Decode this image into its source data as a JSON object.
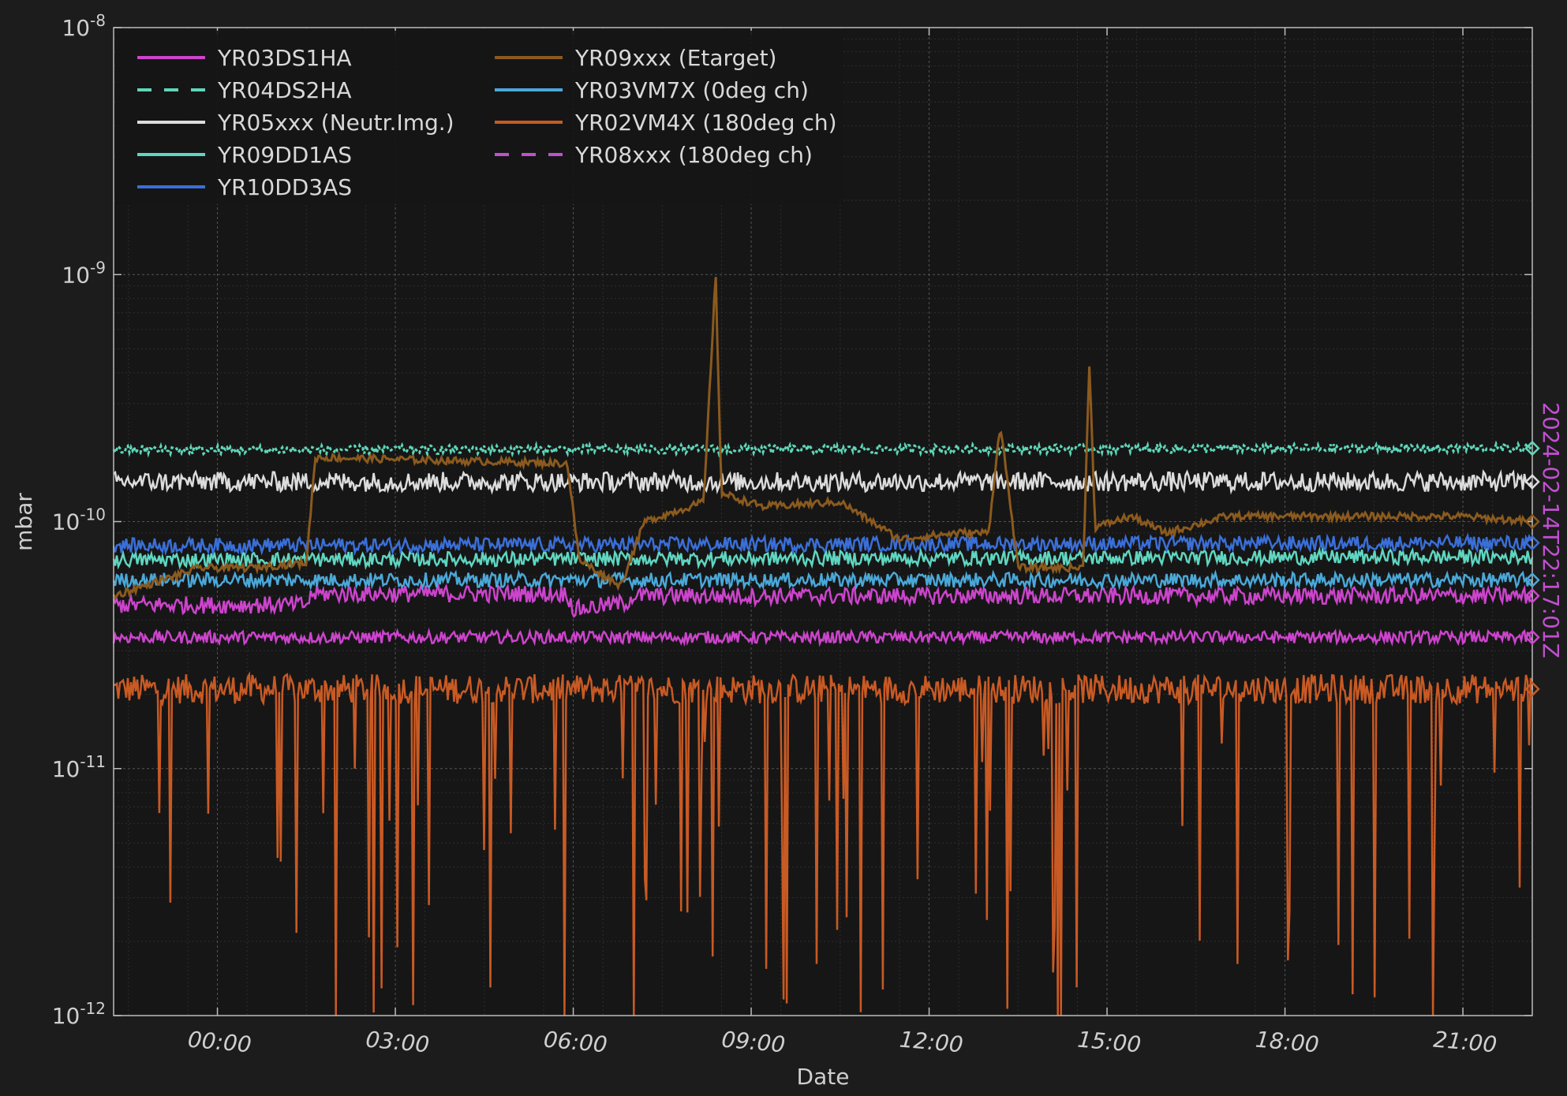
{
  "chart_data": {
    "type": "line",
    "title": "",
    "xlabel": "Date",
    "ylabel": "mbar",
    "y_scale": "log",
    "ylim": [
      1e-12,
      1e-08
    ],
    "x_unit": "hours",
    "xlim": [
      -1.75,
      22.17
    ],
    "x_ticks": [
      {
        "value": 0,
        "label": "00:00"
      },
      {
        "value": 3,
        "label": "03:00"
      },
      {
        "value": 6,
        "label": "06:00"
      },
      {
        "value": 9,
        "label": "09:00"
      },
      {
        "value": 12,
        "label": "12:00"
      },
      {
        "value": 15,
        "label": "15:00"
      },
      {
        "value": 18,
        "label": "18:00"
      },
      {
        "value": 21,
        "label": "21:00"
      }
    ],
    "y_ticks": [
      {
        "value": 1e-12,
        "base": "10",
        "exp": "-12"
      },
      {
        "value": 1e-11,
        "base": "10",
        "exp": "-11"
      },
      {
        "value": 1e-10,
        "base": "10",
        "exp": "-10"
      },
      {
        "value": 1e-09,
        "base": "10",
        "exp": "-9"
      },
      {
        "value": 1e-08,
        "base": "10",
        "exp": "-8"
      }
    ],
    "grid": true,
    "legend_position": "top-left",
    "timestamp": "2024-02-14T22:17:01Z",
    "timestamp_color": "#c050d0",
    "series": [
      {
        "name": "YR03DS1HA",
        "color": "#cc44cc",
        "dash": "solid",
        "points": [
          [
            -1.75,
            4.6e-11
          ],
          [
            1.5,
            4.6e-11
          ],
          [
            1.6,
            5.1e-11
          ],
          [
            5.9,
            5.1e-11
          ],
          [
            6.0,
            4.4e-11
          ],
          [
            6.9,
            4.7e-11
          ],
          [
            7.0,
            5e-11
          ],
          [
            22.17,
            5e-11
          ]
        ]
      },
      {
        "name": "YR03DS1HA",
        "color": "#cc44cc",
        "dash": "solid",
        "points": [
          [
            -1.75,
            3.4e-11
          ],
          [
            22.17,
            3.4e-11
          ]
        ]
      },
      {
        "name": "YR04DS2HA",
        "color": "#5fd6b8",
        "dash": "dashed",
        "points": [
          [
            -1.75,
            1.95e-10
          ],
          [
            22.17,
            1.98e-10
          ]
        ]
      },
      {
        "name": "YR05xxx (Neutr.Img.)",
        "color": "#dcdcdc",
        "dash": "solid",
        "points": [
          [
            -1.75,
            1.45e-10
          ],
          [
            22.17,
            1.45e-10
          ]
        ]
      },
      {
        "name": "YR09DD1AS",
        "color": "#5fd6c0",
        "dash": "solid",
        "points": [
          [
            -1.75,
            7e-11
          ],
          [
            22.17,
            7.2e-11
          ]
        ]
      },
      {
        "name": "YR10DD3AS",
        "color": "#3a6fd8",
        "dash": "solid",
        "points": [
          [
            -1.75,
            8e-11
          ],
          [
            22.17,
            8.2e-11
          ]
        ]
      },
      {
        "name": "YR09xxx (Etarget)",
        "color": "#8b5a1e",
        "dash": "solid",
        "points": [
          [
            -1.75,
            5e-11
          ],
          [
            -0.3,
            6.5e-11
          ],
          [
            0.5,
            6.5e-11
          ],
          [
            1.5,
            6.8e-11
          ],
          [
            1.65,
            1.82e-10
          ],
          [
            5.9,
            1.72e-10
          ],
          [
            6.1,
            7e-11
          ],
          [
            6.8,
            5.5e-11
          ],
          [
            7.2,
            1e-10
          ],
          [
            8.2,
            1.2e-10
          ],
          [
            8.4,
            1e-09
          ],
          [
            8.5,
            1.3e-10
          ],
          [
            9.2,
            1.15e-10
          ],
          [
            10.5,
            1.2e-10
          ],
          [
            11.5,
            8.5e-11
          ],
          [
            12.5,
            9e-11
          ],
          [
            13.0,
            9e-11
          ],
          [
            13.2,
            2.5e-10
          ],
          [
            13.5,
            6.5e-11
          ],
          [
            14.6,
            6.5e-11
          ],
          [
            14.7,
            4.5e-10
          ],
          [
            14.8,
            9.5e-11
          ],
          [
            15.4,
            1.05e-10
          ],
          [
            16.0,
            9e-11
          ],
          [
            17.0,
            1.05e-10
          ],
          [
            19.0,
            1.05e-10
          ],
          [
            21.0,
            1.05e-10
          ],
          [
            22.17,
            1e-10
          ]
        ]
      },
      {
        "name": "YR03VM7X (0deg ch)",
        "color": "#4aa8d8",
        "dash": "solid",
        "points": [
          [
            -1.75,
            5.8e-11
          ],
          [
            22.17,
            5.8e-11
          ]
        ]
      },
      {
        "name": "YR02VM4X (180deg ch)",
        "color": "#c85a24",
        "dash": "solid",
        "points": [
          [
            -1.75,
            2.1e-11
          ],
          [
            22.17,
            2.1e-11
          ]
        ]
      },
      {
        "name": "YR08xxx (180deg ch)",
        "color": "#c050d0",
        "dash": "dashed",
        "points": []
      }
    ]
  }
}
